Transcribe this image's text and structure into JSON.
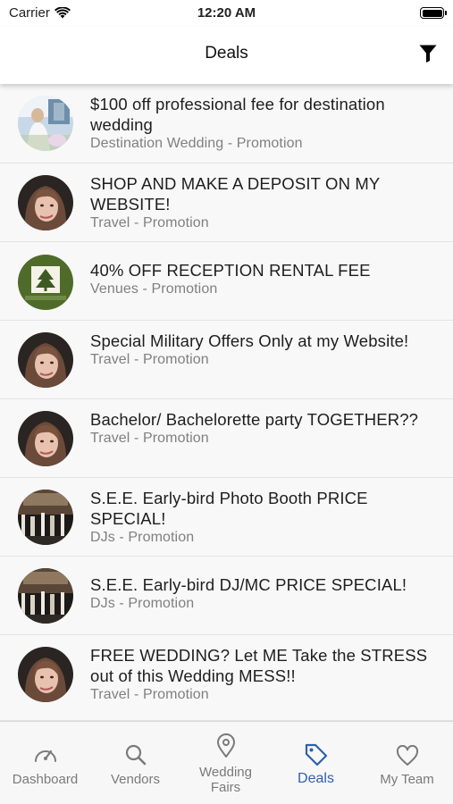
{
  "status_bar": {
    "carrier": "Carrier",
    "time": "12:20 AM"
  },
  "nav": {
    "title": "Deals"
  },
  "deals": [
    {
      "title": "$100 off professional fee for destination wedding",
      "subtitle": "Destination Wedding - Promotion",
      "avatar": "destination-wedding-photo"
    },
    {
      "title": "SHOP AND MAKE A DEPOSIT ON MY WEBSITE!",
      "subtitle": "Travel - Promotion",
      "avatar": "travel-agent-portrait"
    },
    {
      "title": "40% OFF RECEPTION RENTAL FEE",
      "subtitle": "Venues - Promotion",
      "avatar": "venue-tree-logo"
    },
    {
      "title": "Special Military Offers Only at my Website!",
      "subtitle": "Travel - Promotion",
      "avatar": "travel-agent-portrait"
    },
    {
      "title": "Bachelor/ Bachelorette party TOGETHER??",
      "subtitle": "Travel - Promotion",
      "avatar": "travel-agent-portrait"
    },
    {
      "title": "S.E.E. Early-bird Photo Booth PRICE SPECIAL!",
      "subtitle": "DJs - Promotion",
      "avatar": "dj-event-photo"
    },
    {
      "title": "S.E.E. Early-bird DJ/MC PRICE SPECIAL!",
      "subtitle": "DJs - Promotion",
      "avatar": "dj-event-photo"
    },
    {
      "title": "FREE WEDDING? Let ME Take the STRESS out of this Wedding MESS!!",
      "subtitle": "Travel - Promotion",
      "avatar": "travel-agent-portrait"
    }
  ],
  "tabs": [
    {
      "label": "Dashboard",
      "icon": "speedometer-icon",
      "active": false
    },
    {
      "label": "Vendors",
      "icon": "search-icon",
      "active": false
    },
    {
      "label": "Wedding\nFairs",
      "icon": "location-pin-icon",
      "active": false
    },
    {
      "label": "Deals",
      "icon": "tag-icon",
      "active": true
    },
    {
      "label": "My Team",
      "icon": "heart-icon",
      "active": false
    }
  ],
  "colors": {
    "active_tab": "#2f5fb0",
    "inactive_tab": "#7a7a7a",
    "venue_logo_green": "#4f6b2a"
  }
}
